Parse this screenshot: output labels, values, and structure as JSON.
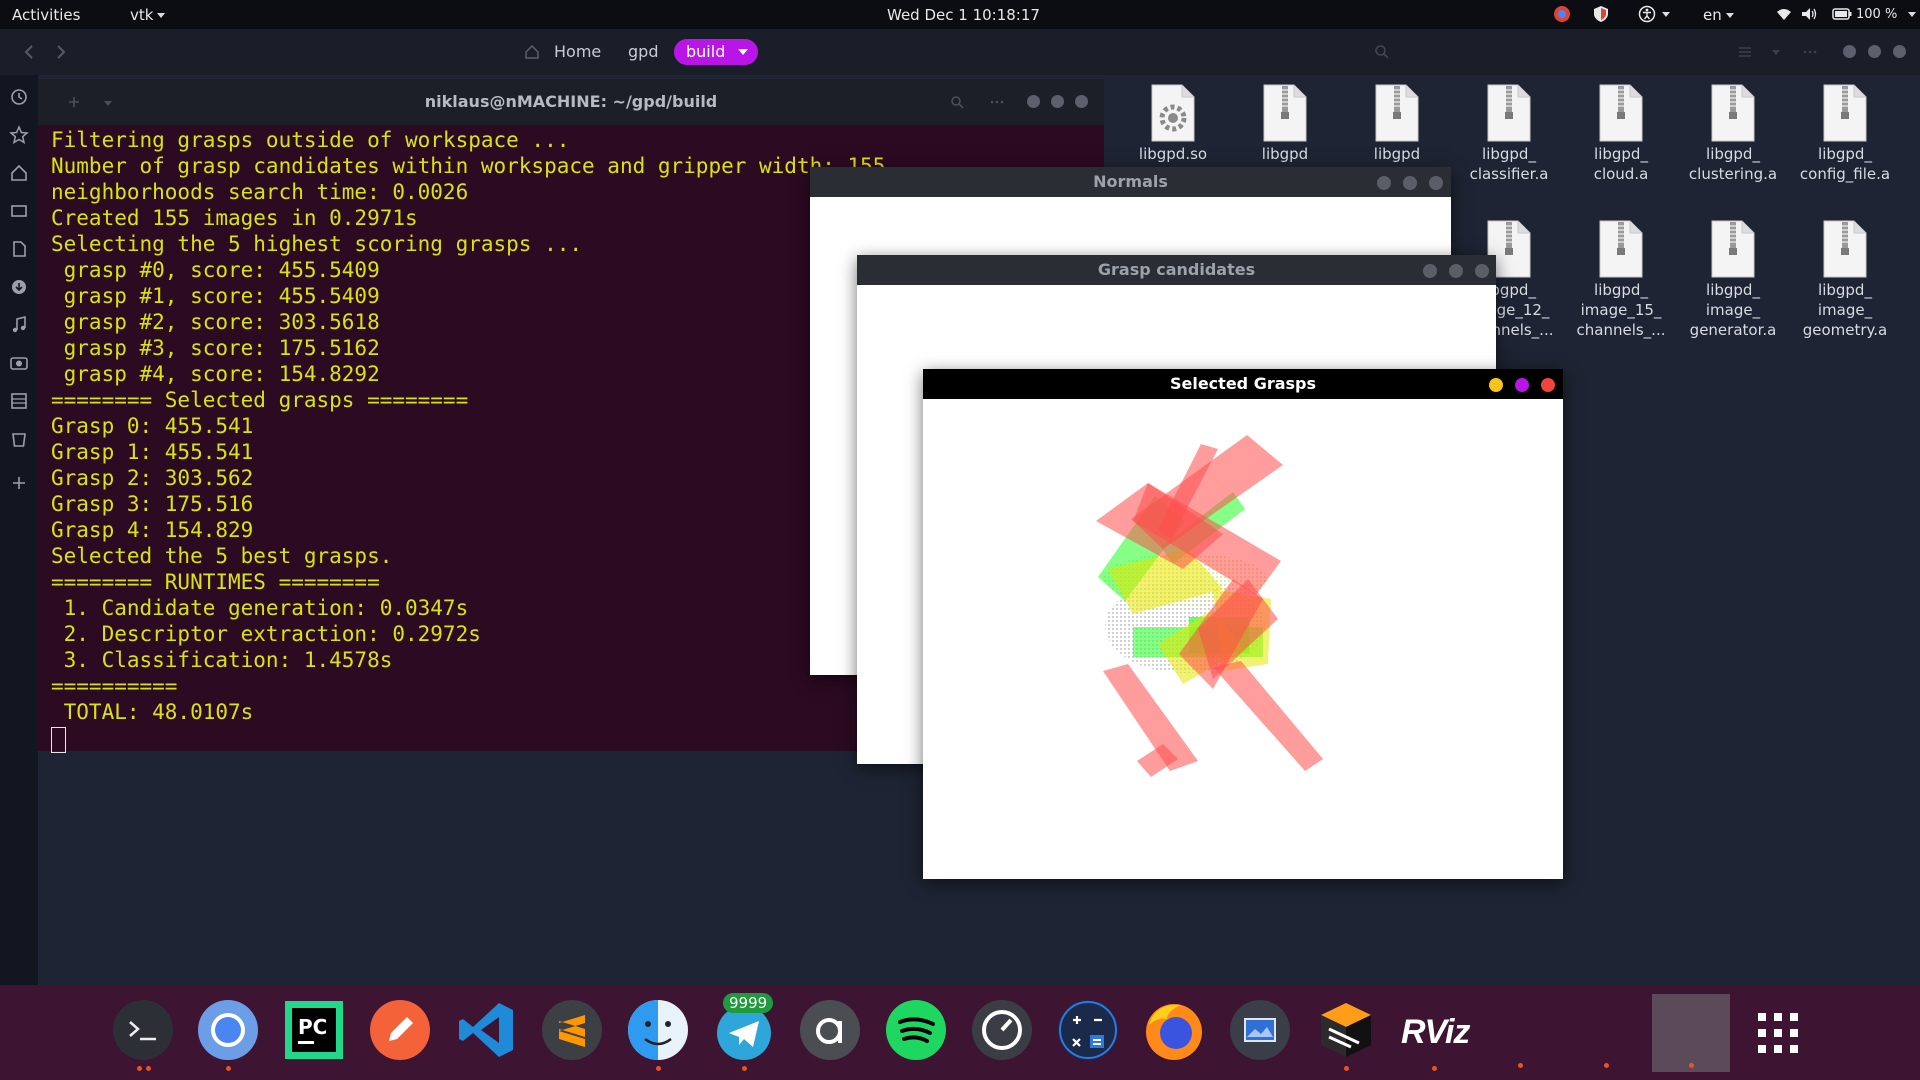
{
  "topbar": {
    "activities": "Activities",
    "app_menu": "vtk",
    "clock": "Wed Dec 1  10:18:17",
    "language": "en",
    "battery": "100 %"
  },
  "nautilus": {
    "crumbs": [
      "Home",
      "gpd",
      "build"
    ]
  },
  "files": [
    {
      "label": "libgpd.so",
      "icon": "gear-file-icon"
    },
    {
      "label": "libgpd",
      "icon": "archive-file-icon"
    },
    {
      "label": "libgpd",
      "icon": "archive-file-icon"
    },
    {
      "label": "libgpd_\nclassifier.a",
      "icon": "archive-file-icon"
    },
    {
      "label": "libgpd_\ncloud.a",
      "icon": "archive-file-icon"
    },
    {
      "label": "libgpd_\nclustering.a",
      "icon": "archive-file-icon"
    },
    {
      "label": "libgpd_\nconfig_file.a",
      "icon": "archive-file-icon"
    },
    {
      "label": "libgpd_\nimage_12_\nchannels_...",
      "icon": "archive-file-icon"
    },
    {
      "label": "libgpd_\nimage_15_\nchannels_...",
      "icon": "archive-file-icon"
    },
    {
      "label": "libgpd_\nimage_\ngenerator.a",
      "icon": "archive-file-icon"
    },
    {
      "label": "libgpd_\nimage_\ngeometry.a",
      "icon": "archive-file-icon"
    }
  ],
  "terminal": {
    "title": "niklaus@nMACHINE: ~/gpd/build",
    "lines": [
      "Filtering grasps outside of workspace ...",
      "Number of grasp candidates within workspace and gripper width: 155",
      "neighborhoods search time: 0.0026",
      "Created 155 images in 0.2971s",
      "Selecting the 5 highest scoring grasps ...",
      " grasp #0, score: 455.5409",
      " grasp #1, score: 455.5409",
      " grasp #2, score: 303.5618",
      " grasp #3, score: 175.5162",
      " grasp #4, score: 154.8292",
      "======== Selected grasps ========",
      "Grasp 0: 455.541",
      "Grasp 1: 455.541",
      "Grasp 2: 303.562",
      "Grasp 3: 175.516",
      "Grasp 4: 154.829",
      "Selected the 5 best grasps.",
      "======== RUNTIMES ========",
      " 1. Candidate generation: 0.0347s",
      " 2. Descriptor extraction: 0.2972s",
      " 3. Classification: 1.4578s",
      "==========",
      " TOTAL: 48.0107s"
    ]
  },
  "windows": {
    "normals": "Normals",
    "candidates": "Grasp candidates",
    "selected": "Selected Grasps"
  },
  "dock": {
    "apps": [
      "terminal-icon",
      "chromium-icon",
      "pycharm-icon",
      "text-editor-icon",
      "vscode-icon",
      "sublime-text-icon",
      "finder-icon",
      "telegram-icon",
      "at-app-icon",
      "spotify-icon",
      "speed-monitor-icon",
      "calculator-icon",
      "firefox-icon",
      "screenshot-icon",
      "sublime-merge-icon",
      "rviz-icon"
    ],
    "telegram_badge": "9999",
    "rviz_label": "RViz"
  },
  "colors": {
    "terminal_bg": "#2c0a22",
    "terminal_text": "#dbe30c",
    "accent": "#b915e6",
    "dock_bg": "#3d1432",
    "grasp_red": "#ff4d4d",
    "grasp_green": "#33ff33",
    "grasp_yellow": "#e5e500"
  }
}
